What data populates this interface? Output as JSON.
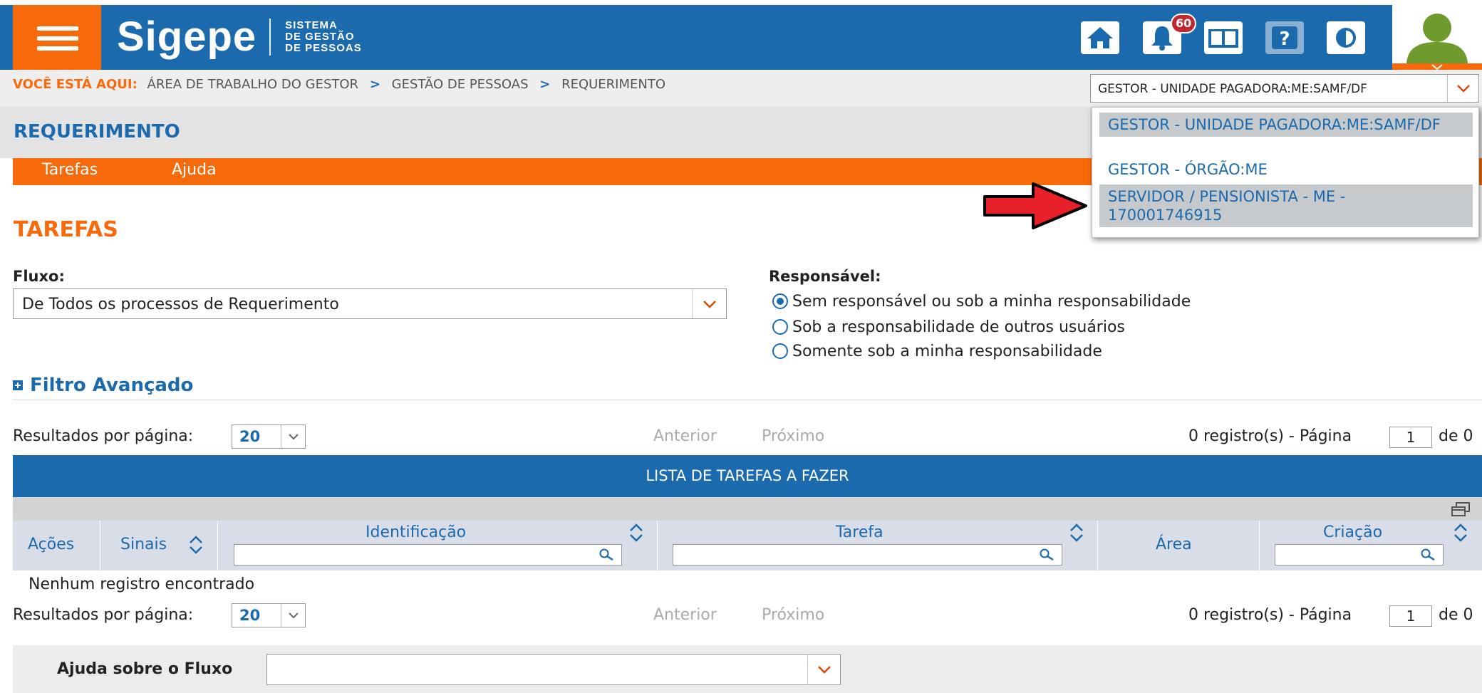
{
  "header": {
    "logo": "Sigepe",
    "logo_sub": [
      "SISTEMA",
      "DE GESTÃO",
      "DE PESSOAS"
    ],
    "notification_count": "60",
    "icons": [
      "home-icon",
      "bell-icon",
      "book-icon",
      "help-icon",
      "contrast-icon"
    ],
    "brand_blue": "#1b6aad",
    "brand_orange": "#f76a0c"
  },
  "breadcrumb": {
    "prefix": "VOCÊ ESTÁ AQUI:",
    "items": [
      "ÁREA DE TRABALHO DO GESTOR",
      "GESTÃO DE PESSOAS",
      "REQUERIMENTO"
    ]
  },
  "profile": {
    "selected": "GESTOR - UNIDADE PAGADORA:ME:SAMF/DF",
    "options": [
      "GESTOR - UNIDADE PAGADORA:ME:SAMF/DF",
      "GESTOR - ÓRGÃO:ME",
      "SERVIDOR / PENSIONISTA - ME - 170001746915"
    ]
  },
  "page": {
    "title": "REQUERIMENTO",
    "tabs": [
      "Tarefas",
      "Ajuda"
    ]
  },
  "tarefas": {
    "title": "TAREFAS",
    "fluxo_label": "Fluxo:",
    "fluxo_value": "De Todos os processos de Requerimento",
    "responsavel_label": "Responsável:",
    "radios": [
      {
        "label": "Sem responsável ou sob a minha responsabilidade",
        "checked": true
      },
      {
        "label": "Sob a responsabilidade de outros usuários",
        "checked": false
      },
      {
        "label": "Somente sob a minha responsabilidade",
        "checked": false
      }
    ],
    "advanced_filter": "Filtro Avançado"
  },
  "pagination": {
    "per_page_label": "Resultados por página:",
    "per_page": "20",
    "prev": "Anterior",
    "next": "Próximo",
    "records": "0 registro(s) - Página",
    "page": "1",
    "of": "de 0"
  },
  "table": {
    "title": "LISTA DE TAREFAS A FAZER",
    "columns": [
      "Ações",
      "Sinais",
      "Identificação",
      "Tarefa",
      "Área",
      "Criação"
    ],
    "empty": "Nenhum registro encontrado"
  },
  "help": {
    "label": "Ajuda sobre o Fluxo",
    "value": ""
  }
}
